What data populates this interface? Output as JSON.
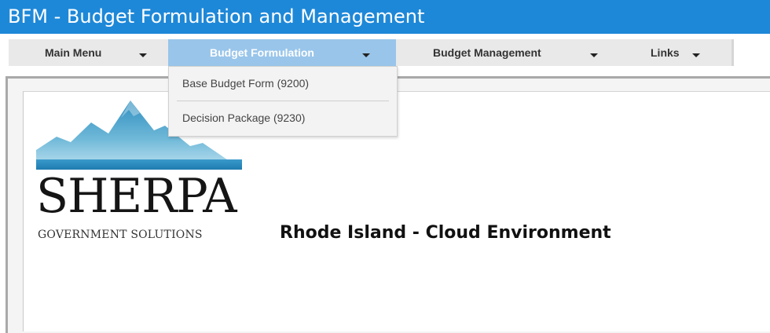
{
  "window": {
    "title": "BFM - Budget Formulation and Management"
  },
  "menu": {
    "items": [
      {
        "label": "Main Menu",
        "icon": "chevron-down-icon"
      },
      {
        "label": "Budget Formulation",
        "icon": "chevron-down-icon",
        "active": true
      },
      {
        "label": "Budget Management",
        "icon": "chevron-down-icon"
      },
      {
        "label": "Links",
        "icon": "chevron-down-icon"
      }
    ],
    "dropdown": [
      {
        "label": "Base Budget Form (9200)"
      },
      {
        "label": "Decision Package (9230)"
      }
    ]
  },
  "logo": {
    "wordmark": "SHERPA",
    "tagline": "GOVERNMENT SOLUTIONS",
    "icon": "mountain-logo-icon"
  },
  "main": {
    "environment_title": "Rhode Island - Cloud Environment"
  },
  "colors": {
    "titlebar": "#1e88d8",
    "menu_active": "#99c5ea",
    "menubar": "#e9e9e9",
    "mountain_top": "#2f8fc0",
    "mountain_bottom": "#bfe3f1"
  }
}
